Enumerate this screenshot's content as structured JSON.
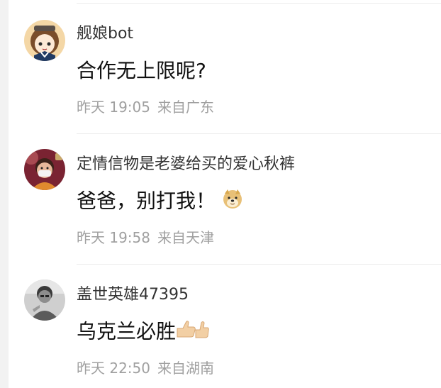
{
  "comments": [
    {
      "username": "舰娘bot",
      "content": "合作无上限呢?",
      "time": "昨天 19:05",
      "location": "来自广东",
      "avatar": "anime-girl-avatar"
    },
    {
      "username": "定情信物是老婆给买的爱心秋裤",
      "content": "爸爸，别打我！",
      "emoji": "doge-icon",
      "time": "昨天 19:58",
      "location": "来自天津",
      "avatar": "masked-person-avatar"
    },
    {
      "username": "盖世英雄47395",
      "content": "乌克兰必胜",
      "emoji": "thumbs-up-icon",
      "time": "昨天 22:50",
      "location": "来自湖南",
      "avatar": "grayscale-person-avatar"
    }
  ],
  "colors": {
    "username": "#333333",
    "content": "#111111",
    "meta": "#a0a0a0",
    "divider": "#ececec"
  }
}
